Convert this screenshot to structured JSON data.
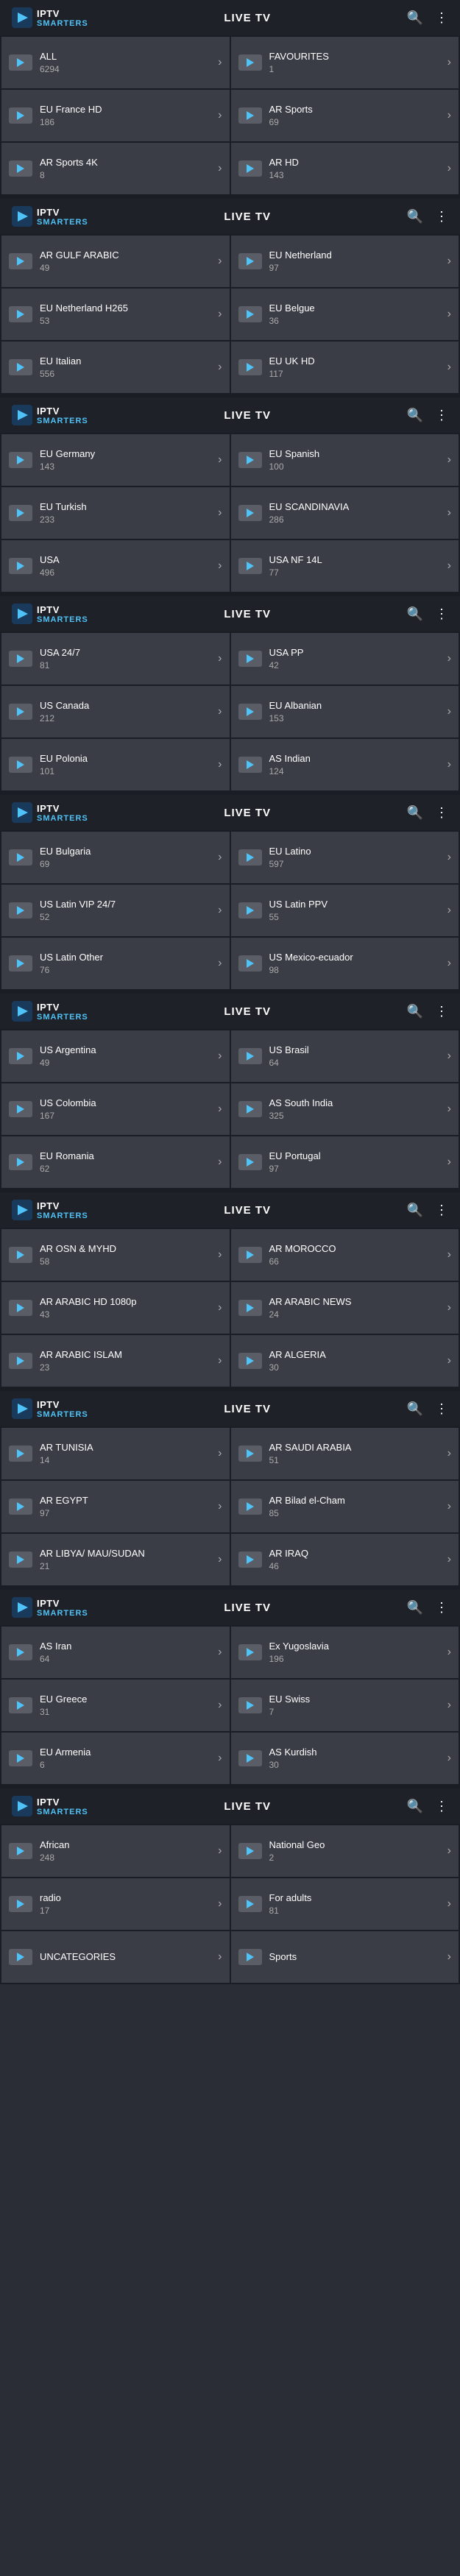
{
  "sections": [
    {
      "id": "section1",
      "header": {
        "title": "LIVE TV",
        "logo_line1": "IPTV",
        "logo_line2": "SMARTERS"
      },
      "cards": [
        {
          "name": "ALL",
          "count": "6294"
        },
        {
          "name": "FAVOURITES",
          "count": "1"
        },
        {
          "name": "EU France HD",
          "count": "186"
        },
        {
          "name": "AR Sports",
          "count": "69"
        },
        {
          "name": "AR Sports 4K",
          "count": "8"
        },
        {
          "name": "AR HD",
          "count": "143"
        }
      ]
    },
    {
      "id": "section2",
      "header": {
        "title": "LIVE TV",
        "logo_line1": "IPTV",
        "logo_line2": "SMARTERS"
      },
      "cards": [
        {
          "name": "AR GULF ARABIC",
          "count": "49"
        },
        {
          "name": "EU Netherland",
          "count": "97"
        },
        {
          "name": "EU Netherland H265",
          "count": "53"
        },
        {
          "name": "EU Belgue",
          "count": "36"
        },
        {
          "name": "EU Italian",
          "count": "556"
        },
        {
          "name": "EU UK HD",
          "count": "117"
        }
      ]
    },
    {
      "id": "section3",
      "header": {
        "title": "LIVE TV",
        "logo_line1": "IPTV",
        "logo_line2": "SMARTERS"
      },
      "cards": [
        {
          "name": "EU Germany",
          "count": "143"
        },
        {
          "name": "EU Spanish",
          "count": "100"
        },
        {
          "name": "EU Turkish",
          "count": "233"
        },
        {
          "name": "EU SCANDINAVIA",
          "count": "286"
        },
        {
          "name": "USA",
          "count": "496"
        },
        {
          "name": "USA NF 14L",
          "count": "77"
        }
      ]
    },
    {
      "id": "section4",
      "header": {
        "title": "LIVE TV",
        "logo_line1": "IPTV",
        "logo_line2": "SMARTERS"
      },
      "cards": [
        {
          "name": "USA 24/7",
          "count": "81"
        },
        {
          "name": "USA PP",
          "count": "42"
        },
        {
          "name": "US Canada",
          "count": "212"
        },
        {
          "name": "EU Albanian",
          "count": "153"
        },
        {
          "name": "EU Polonia",
          "count": "101"
        },
        {
          "name": "AS Indian",
          "count": "124"
        }
      ]
    },
    {
      "id": "section5",
      "header": {
        "title": "LIVE TV",
        "logo_line1": "IPTV",
        "logo_line2": "SMARTERS"
      },
      "cards": [
        {
          "name": "EU Bulgaria",
          "count": "69"
        },
        {
          "name": "EU Latino",
          "count": "597"
        },
        {
          "name": "US Latin VIP 24/7",
          "count": "52"
        },
        {
          "name": "US Latin PPV",
          "count": "55"
        },
        {
          "name": "US Latin Other",
          "count": "76"
        },
        {
          "name": "US Mexico-ecuador",
          "count": "98"
        }
      ]
    },
    {
      "id": "section6",
      "header": {
        "title": "LIVE TV",
        "logo_line1": "IPTV",
        "logo_line2": "SMARTERS"
      },
      "cards": [
        {
          "name": "US Argentina",
          "count": "49"
        },
        {
          "name": "US Brasil",
          "count": "64"
        },
        {
          "name": "US Colombia",
          "count": "167"
        },
        {
          "name": "AS South India",
          "count": "325"
        },
        {
          "name": "EU Romania",
          "count": "62"
        },
        {
          "name": "EU Portugal",
          "count": "97"
        }
      ]
    },
    {
      "id": "section7",
      "header": {
        "title": "LIVE TV",
        "logo_line1": "IPTV",
        "logo_line2": "SMARTERS"
      },
      "cards": [
        {
          "name": "AR OSN & MYHD",
          "count": "58"
        },
        {
          "name": "AR MOROCCO",
          "count": "66"
        },
        {
          "name": "AR ARABIC HD 1080p",
          "count": "43"
        },
        {
          "name": "AR ARABIC NEWS",
          "count": "24"
        },
        {
          "name": "AR ARABIC ISLAM",
          "count": "23"
        },
        {
          "name": "AR ALGERIA",
          "count": "30"
        }
      ]
    },
    {
      "id": "section8",
      "header": {
        "title": "LIVE TV",
        "logo_line1": "IPTV",
        "logo_line2": "SMARTERS"
      },
      "cards": [
        {
          "name": "AR TUNISIA",
          "count": "14"
        },
        {
          "name": "AR SAUDI ARABIA",
          "count": "51"
        },
        {
          "name": "AR EGYPT",
          "count": "97"
        },
        {
          "name": "AR Bilad el-Cham",
          "count": "85"
        },
        {
          "name": "AR LIBYA/ MAU/SUDAN",
          "count": "21"
        },
        {
          "name": "AR IRAQ",
          "count": "46"
        }
      ]
    },
    {
      "id": "section9",
      "header": {
        "title": "LIVE TV",
        "logo_line1": "IPTV",
        "logo_line2": "SMARTERS"
      },
      "cards": [
        {
          "name": "AS Iran",
          "count": "64"
        },
        {
          "name": "Ex Yugoslavia",
          "count": "196"
        },
        {
          "name": "EU Greece",
          "count": "31"
        },
        {
          "name": "EU Swiss",
          "count": "7"
        },
        {
          "name": "EU Armenia",
          "count": "6"
        },
        {
          "name": "AS Kurdish",
          "count": "30"
        }
      ]
    },
    {
      "id": "section10",
      "header": {
        "title": "LIVE TV",
        "logo_line1": "IPTV",
        "logo_line2": "SMARTERS"
      },
      "cards": [
        {
          "name": "African",
          "count": "248"
        },
        {
          "name": "National Geo",
          "count": "2"
        },
        {
          "name": "radio",
          "count": "17"
        },
        {
          "name": "For adults",
          "count": "81"
        },
        {
          "name": "UNCATEGORIES",
          "count": ""
        },
        {
          "name": "Sports",
          "count": ""
        }
      ]
    }
  ],
  "icons": {
    "search": "🔍",
    "more": "⋮",
    "logo_symbol": "▶"
  }
}
